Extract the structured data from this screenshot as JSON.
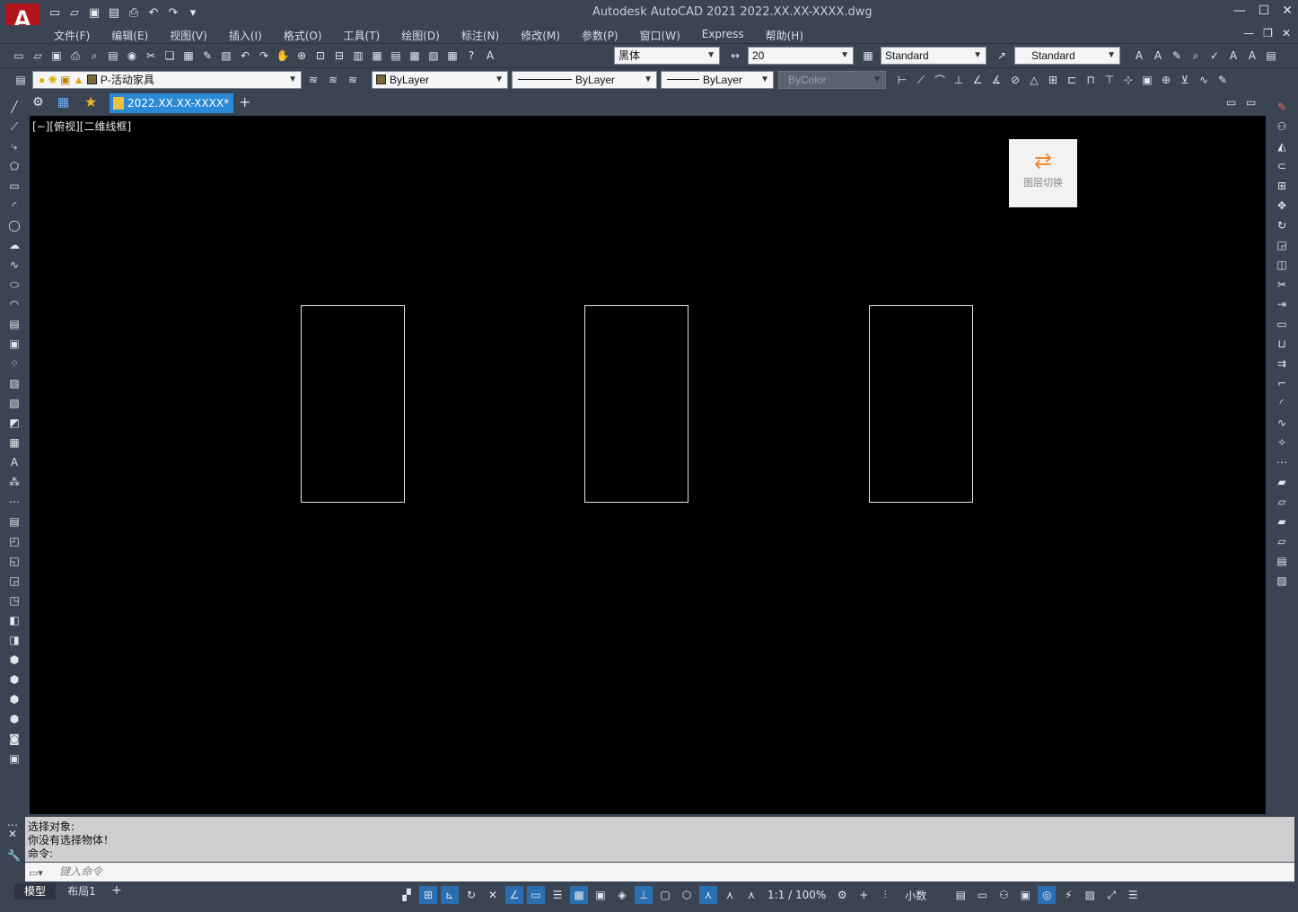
{
  "app": {
    "logo_letter": "A",
    "title": "Autodesk AutoCAD 2021    2022.XX.XX-XXXX.dwg"
  },
  "menu": [
    "文件(F)",
    "编辑(E)",
    "视图(V)",
    "插入(I)",
    "格式(O)",
    "工具(T)",
    "绘图(D)",
    "标注(N)",
    "修改(M)",
    "参数(P)",
    "窗口(W)",
    "Express",
    "帮助(H)"
  ],
  "toolbar_styles": {
    "text_font": "黑体",
    "text_height": "20",
    "table_style": "Standard",
    "multileader_style": "Standard"
  },
  "toolbar_properties": {
    "layer": "P-活动家具",
    "color": "ByLayer",
    "linetype": "ByLayer",
    "lineweight": "ByLayer",
    "plotstyle": "ByColor"
  },
  "document_tab": {
    "label": "2022.XX.XX-XXXX*",
    "plus": "+"
  },
  "viewport": {
    "label": "[−][俯视][二维线框]",
    "layer_switch_label": "图层切换",
    "rectangles": 3
  },
  "command": {
    "history": [
      "选择对象:",
      "你没有选择物体！",
      "命令:"
    ],
    "placeholder": "键入命令"
  },
  "layout_tabs": [
    "模型",
    "布局1"
  ],
  "layout_plus": "+",
  "status": {
    "scale": "1:1 / 100%",
    "units": "小数"
  },
  "colors": {
    "chrome": "#3b4453",
    "canvas": "#000000",
    "active_tab": "#2a8ad8",
    "logo": "#b4141c"
  }
}
